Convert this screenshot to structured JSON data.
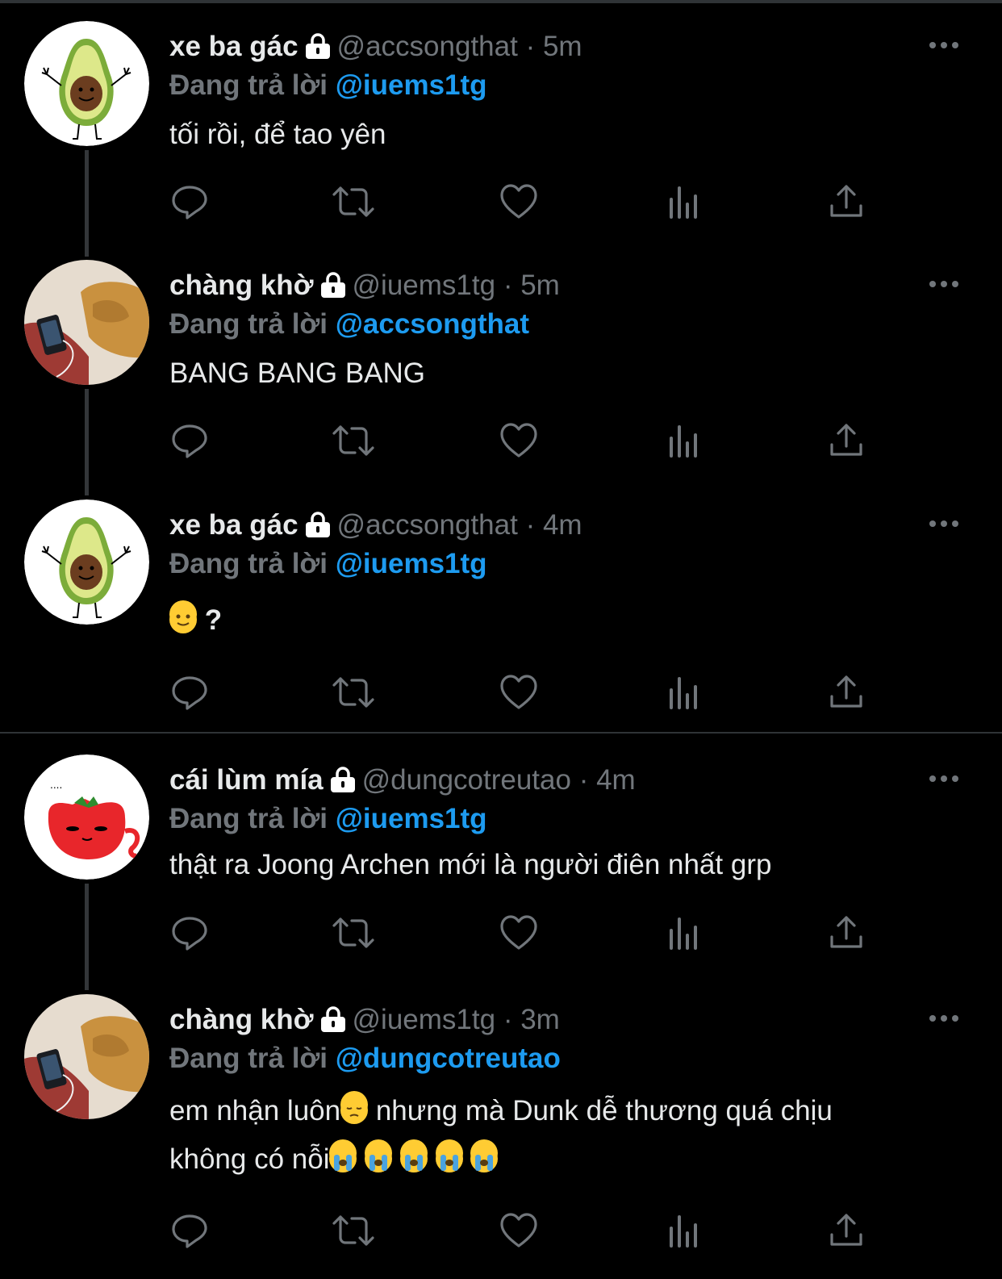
{
  "tweets": [
    {
      "name": "xe ba gác",
      "handle": "@accsongthat",
      "dot": "·",
      "time": "5m",
      "reply_prefix": "Đang trả lời",
      "reply_to": "@iuems1tg",
      "text": "tối rồi, để tao yên",
      "avatar": "avocado"
    },
    {
      "name": "chàng khờ",
      "handle": "@iuems1tg",
      "dot": "·",
      "time": "5m",
      "reply_prefix": "Đang trả lời",
      "reply_to": "@accsongthat",
      "text": "BANG BANG BANG",
      "avatar": "dog"
    },
    {
      "name": "xe ba gác",
      "handle": "@accsongthat",
      "dot": "·",
      "time": "4m",
      "reply_prefix": "Đang trả lời",
      "reply_to": "@iuems1tg",
      "text": "?",
      "text_emoji": "slightly-smiling-face",
      "avatar": "avocado"
    },
    {
      "name": "cái lùm mía",
      "handle": "@dungcotreutao",
      "dot": "·",
      "time": "4m",
      "reply_prefix": "Đang trả lời",
      "reply_to": "@iuems1tg",
      "text": "thật ra Joong Archen mới là người điên nhất grp",
      "avatar": "tomato-cat"
    },
    {
      "name": "chàng khờ",
      "handle": "@iuems1tg",
      "dot": "·",
      "time": "3m",
      "reply_prefix": "Đang trả lời",
      "reply_to": "@dungcotreutao",
      "text_part1": "em nhận luôn",
      "text_part2": " nhưng mà Dunk dễ thương quá chịu",
      "text_part3": "không có nỗi",
      "avatar": "dog"
    }
  ],
  "icons": [
    "reply-icon",
    "retweet-icon",
    "like-icon",
    "views-icon",
    "share-icon",
    "more-icon",
    "lock-icon"
  ],
  "colors": {
    "background": "#000000",
    "text": "#e7e9ea",
    "muted": "#71767b",
    "link": "#1d9bf0",
    "separator": "#2f3336"
  }
}
